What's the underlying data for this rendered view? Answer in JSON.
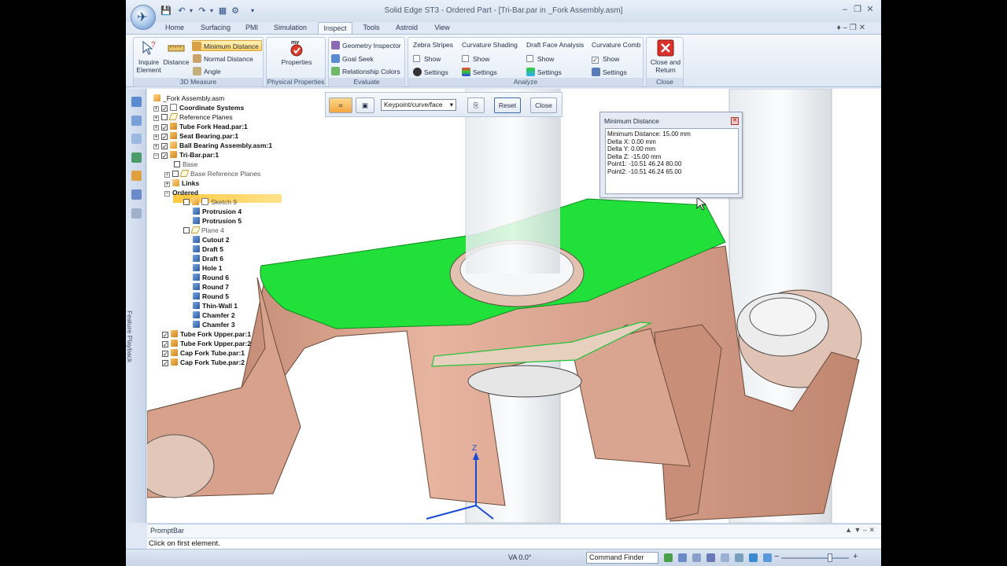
{
  "window": {
    "title": "Solid Edge ST3 - Ordered Part - [Tri-Bar.par in _Fork Assembly.asm]"
  },
  "tabs": [
    "Home",
    "Surfacing",
    "PMI",
    "Simulation",
    "Inspect",
    "Tools",
    "Astroid",
    "View"
  ],
  "active_tab": "Inspect",
  "ribbon": {
    "measure_3d": {
      "label": "3D Measure",
      "inquire_element": "Inquire Element",
      "distance": "Distance",
      "minimum_distance": "Minimum Distance",
      "normal_distance": "Normal Distance",
      "angle": "Angle"
    },
    "physical_properties": {
      "label": "Physical Properties",
      "properties": "Properties",
      "icon_text": "mv"
    },
    "evaluate": {
      "label": "Evaluate",
      "geometry_inspector": "Geometry Inspector",
      "goal_seek": "Goal Seek",
      "relationship_colors": "Relationship Colors"
    },
    "analyze": {
      "label": "Analyze",
      "zebra_stripes": "Zebra Stripes",
      "curvature_shading": "Curvature Shading",
      "draft_face_analysis": "Draft Face Analysis",
      "curvature_comb": "Curvature Comb",
      "show": "Show",
      "settings": "Settings"
    },
    "close": {
      "label": "Close",
      "close_and_return": "Close and Return"
    }
  },
  "tree": {
    "root": "_Fork Assembly.asm",
    "coordinate_systems": "Coordinate Systems",
    "reference_planes": "Reference Planes",
    "tube_fork_head": "Tube Fork Head.par:1",
    "seat_bearing": "Seat Bearing.par:1",
    "ball_bearing_assembly": "Ball Bearing Assembly.asm:1",
    "tri_bar": "Tri-Bar.par:1",
    "base": "Base",
    "base_reference_planes": "Base Reference Planes",
    "links": "Links",
    "ordered": "Ordered",
    "sketch_9": "Sketch 9",
    "protrusion_4": "Protrusion 4",
    "protrusion_5": "Protrusion 5",
    "plane_4": "Plane 4",
    "cutout_2": "Cutout 2",
    "draft_5": "Draft 5",
    "draft_6": "Draft 6",
    "hole_1": "Hole 1",
    "round_6": "Round 6",
    "round_7": "Round 7",
    "round_5": "Round 5",
    "thin_wall_1": "Thin-Wall 1",
    "chamfer_2": "Chamfer 2",
    "chamfer_3": "Chamfer 3",
    "tube_fork_upper_1": "Tube Fork Upper.par:1",
    "tube_fork_upper_2": "Tube Fork Upper.par:2",
    "cap_fork_tube_1": "Cap Fork Tube.par:1",
    "cap_fork_tube_2": "Cap Fork Tube.par:2"
  },
  "command_bar": {
    "select_mode": "Keypoint/curve/face",
    "reset": "Reset",
    "close": "Close"
  },
  "minimum_distance_dialog": {
    "title": "Minimum Distance",
    "lines": [
      "Minimum Distance: 15.00 mm",
      "Delta X: 0.00 mm",
      "Delta Y: 0.00 mm",
      "Delta Z: -15.00 mm",
      "Point1:  -10.51 46.24 80.00",
      "Point2:  -10.51 46.24 65.00"
    ]
  },
  "side_tab": "Feature Playback",
  "triad": {
    "x": "X",
    "y": "Y",
    "z": "Z"
  },
  "prompt_bar": {
    "title": "PromptBar",
    "text": "Click on first element."
  },
  "status_bar": {
    "view_angle": "VA 0.0°",
    "command_finder": "Command Finder"
  },
  "colors": {
    "highlight_green": "#22e03a",
    "part_copper": "#d9a088",
    "selected_orange": "#ffc940",
    "ribbon_blue": "#dfe8f4"
  }
}
